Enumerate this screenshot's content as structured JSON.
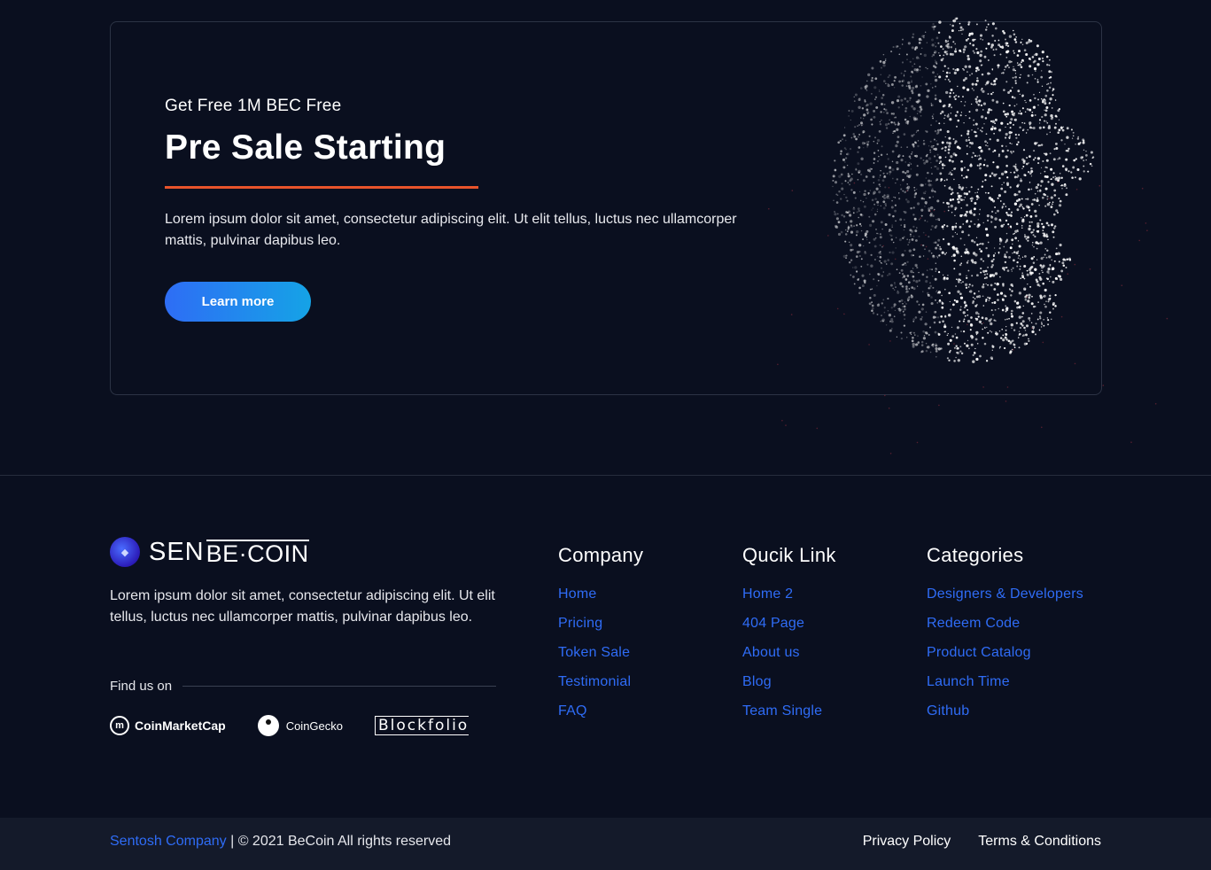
{
  "presale": {
    "kicker": "Get Free 1M BEC Free",
    "title": "Pre Sale Starting",
    "description": "Lorem ipsum dolor sit amet, consectetur adipiscing elit. Ut elit tellus, luctus nec ullamcorper mattis, pulvinar dapibus leo.",
    "button_label": "Learn more",
    "accent_color": "#e8532b"
  },
  "brand": {
    "name_part1": "SEN",
    "name_part2": "BE·COIN"
  },
  "footer": {
    "description": "Lorem ipsum dolor sit amet, consectetur adipiscing elit. Ut elit tellus, luctus nec ullamcorper mattis, pulvinar dapibus leo.",
    "find_us_label": "Find us on",
    "partners": [
      "CoinMarketCap",
      "CoinGecko",
      "Blockfolio"
    ],
    "columns": [
      {
        "title": "Company",
        "links": [
          "Home",
          "Pricing",
          "Token Sale",
          "Testimonial",
          "FAQ"
        ]
      },
      {
        "title": "Qucik Link",
        "links": [
          "Home 2",
          "404 Page",
          "About us",
          "Blog",
          "Team Single"
        ]
      },
      {
        "title": "Categories",
        "links": [
          "Designers & Developers",
          "Redeem Code",
          "Product Catalog",
          "Launch Time",
          "Github"
        ]
      }
    ],
    "link_color": "#2f6cf6"
  },
  "bottom": {
    "company_link": "Sentosh Company",
    "copyright": " | © 2021 BeCoin All rights reserved",
    "privacy": "Privacy Policy",
    "terms": "Terms & Conditions"
  }
}
